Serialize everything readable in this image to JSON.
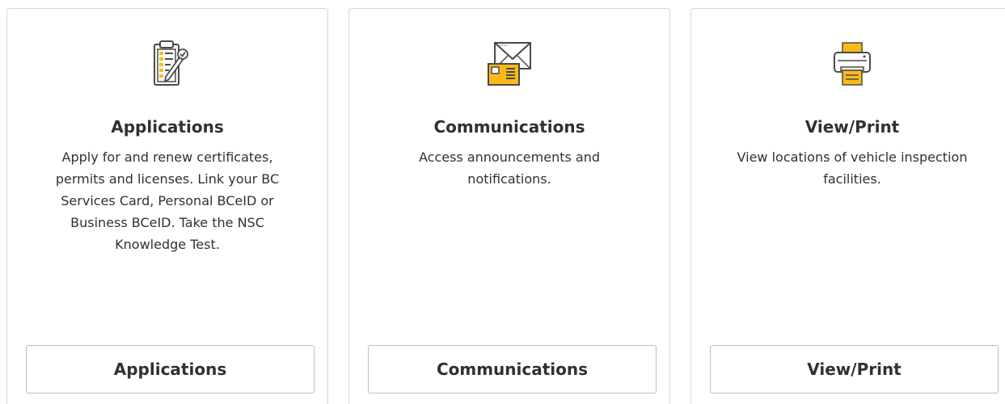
{
  "colors": {
    "accent": "#fcba19",
    "text": "#313132",
    "border": "#d6d6d6",
    "icon_stroke": "#4a4a4a"
  },
  "cards": [
    {
      "icon": "clipboard-checklist-icon",
      "title": "Applications",
      "description": "Apply for and renew certificates, permits and licenses. Link your BC Services Card, Personal BCeID or Business BCeID. Take the NSC Knowledge Test.",
      "button_label": "Applications"
    },
    {
      "icon": "envelope-letter-icon",
      "title": "Communications",
      "description": "Access announcements and notifications.",
      "button_label": "Communications"
    },
    {
      "icon": "printer-icon",
      "title": "View/Print",
      "description": "View locations of vehicle inspection facilities.",
      "button_label": "View/Print"
    }
  ]
}
